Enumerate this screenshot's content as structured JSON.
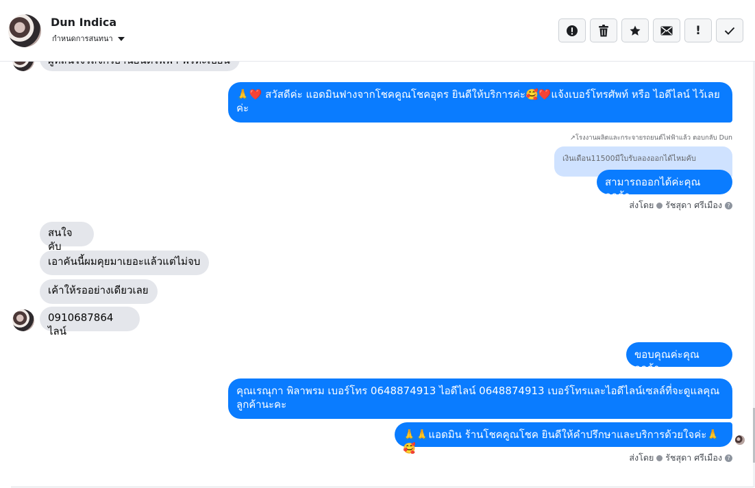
{
  "header": {
    "contact_name": "Dun Indica",
    "assign_label": "กำหนดการสนทนา",
    "toolbar": [
      {
        "icon": "alert-circle-icon",
        "label": "Mark as spam"
      },
      {
        "icon": "trash-icon",
        "label": "Delete"
      },
      {
        "icon": "star-icon",
        "label": "Star"
      },
      {
        "icon": "envelope-icon",
        "label": "Mark as unread"
      },
      {
        "icon": "exclamation-icon",
        "glyph": "!",
        "label": "Follow up"
      },
      {
        "icon": "checkmark-icon",
        "label": "Mark as done"
      }
    ]
  },
  "messages": {
    "cut_off_incoming": "ผู้ที่สนใจรถจักรยานยนต์ไฟฟ้า ฟรีทะเบียน",
    "outgoing_greeting": "🙏❤️ สวัสดีค่ะ แอดมินฟางจากโชคคูณโชคอุดร ยินดีให้บริการค่ะ🥰❤️แจ้งเบอร์โทรศัพท์ หรือ ไอดีไลน์  ไว้เลย ค่ะ",
    "reply_context": "↗โรงงานผลิตและกระจายรถยนต์ไฟฟ้าแล้ว ตอบกลับ Dun",
    "quoted_message": "เงินเดือน11500มีใบรับลองออกได้ไหมคับ",
    "outgoing_reply": "สามารถออกได้ค่ะคุณลูกค้า",
    "sent_by_1": {
      "prefix": "ส่งโดย",
      "name": "รัชสุดา ศรีเมือง"
    },
    "incoming_1": "สนใจคับ",
    "incoming_2": "เอาคันนี้ผมคุยมาเยอะแล้วแต่ไม่จบ",
    "incoming_3": "เค้าให้รออย่างเดียวเลย",
    "incoming_4": "0910687864 ไลน์",
    "outgoing_thanks": "ขอบคุณค่ะคุณลูกค้า",
    "outgoing_contact": "คุณเรณุกา พิลาพรม        เบอร์โทร 0648874913  ไอดีไลน์ 0648874913  เบอร์โทรและไอดีไลน์เซลล์ที่จะดูแลคุณลูกค้านะคะ",
    "outgoing_closing": "🙏🙏แอดมิน ร้านโชคคูณโชค ยินดีให้คำปรึกษาและบริการด้วยใจค่ะ🙏🥰",
    "sent_by_2": {
      "prefix": "ส่งโดย",
      "name": "รัชสุดา ศรีเมือง"
    }
  },
  "colors": {
    "outgoing_bubble": "#0a7cff",
    "incoming_bubble": "#e4e6eb",
    "quoted_bubble": "#cfe2ff"
  }
}
